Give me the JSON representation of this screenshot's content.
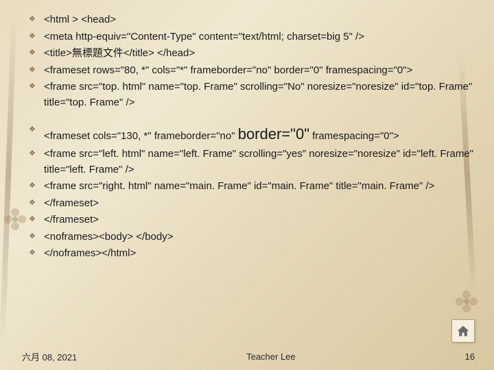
{
  "slide": {
    "group1": [
      "<html > <head>",
      "<meta http-equiv=\"Content-Type\" content=\"text/html; charset=big 5\" />",
      "<title>無標題文件</title> </head>",
      "<frameset rows=\"80, *\" cols=\"*\" frameborder=\"no\" border=\"0\" framespacing=\"0\">",
      "<frame src=\"top. html\" name=\"top. Frame\" scrolling=\"No\" noresize=\"noresize\" id=\"top. Frame\" title=\"top. Frame\" />"
    ],
    "group2_line1_pre": "<frameset cols=\"130, *\" frameborder=\"no\" ",
    "group2_line1_emph": "border=\"0\"",
    "group2_line1_post": " framespacing=\"0\">",
    "group2_rest": [
      "<frame src=\"left. html\" name=\"left. Frame\" scrolling=\"yes\" noresize=\"noresize\" id=\"left. Frame\" title=\"left. Frame\" />",
      "<frame src=\"right. html\" name=\"main. Frame\" id=\"main. Frame\" title=\"main. Frame\" />",
      "</frameset>",
      "</frameset>",
      "<noframes><body> </body>",
      "</noframes></html>"
    ]
  },
  "footer": {
    "date": "六月 08, 2021",
    "author": "Teacher Lee",
    "page": "16"
  },
  "icons": {
    "home": "house-icon"
  }
}
